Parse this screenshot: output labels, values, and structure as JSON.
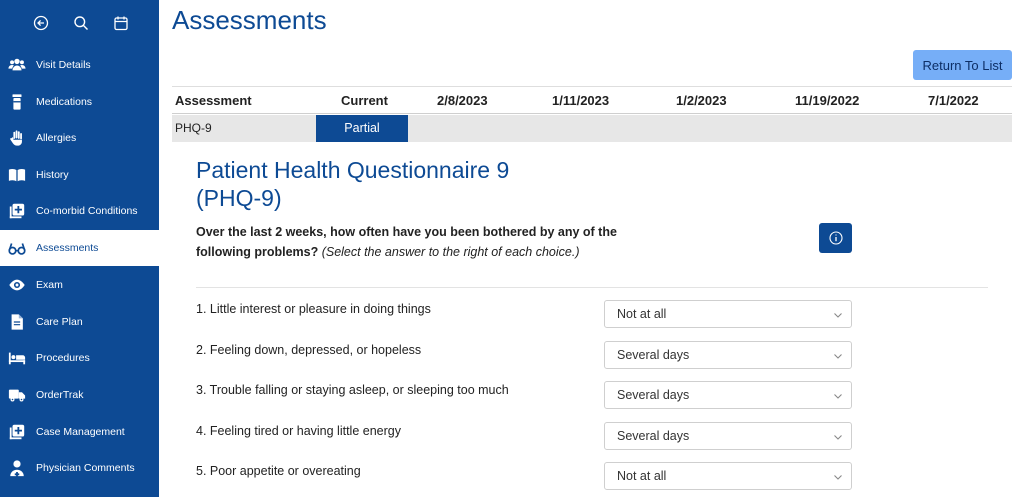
{
  "sidebar": {
    "items": [
      {
        "label": "Visit Details",
        "icon": "users-icon"
      },
      {
        "label": "Medications",
        "icon": "pill-bottle-icon"
      },
      {
        "label": "Allergies",
        "icon": "hand-icon"
      },
      {
        "label": "History",
        "icon": "book-icon"
      },
      {
        "label": "Co-morbid Conditions",
        "icon": "medical-plus-icon"
      },
      {
        "label": "Assessments",
        "icon": "glasses-icon"
      },
      {
        "label": "Exam",
        "icon": "eye-icon"
      },
      {
        "label": "Care Plan",
        "icon": "document-icon"
      },
      {
        "label": "Procedures",
        "icon": "bed-icon"
      },
      {
        "label": "OrderTrak",
        "icon": "truck-icon"
      },
      {
        "label": "Case Management",
        "icon": "medical-plus-icon"
      },
      {
        "label": "Physician Comments",
        "icon": "doctor-icon"
      }
    ],
    "active": "Assessments"
  },
  "header": {
    "title": "Assessments",
    "return_label": "Return To List"
  },
  "table": {
    "columns": [
      "Assessment",
      "Current",
      "2/8/2023",
      "1/11/2023",
      "1/2/2023",
      "11/19/2022",
      "7/1/2022"
    ],
    "row": {
      "name": "PHQ-9",
      "current": "Partial"
    }
  },
  "form": {
    "title": "Patient Health Questionnaire 9 (PHQ-9)",
    "intro_bold": "Over the last 2 weeks, how often have you been bothered by any of the following problems?",
    "intro_italic": "(Select the answer to the right of each choice.)",
    "questions": [
      {
        "label": "1. Little interest or pleasure in doing things",
        "answer": "Not at all"
      },
      {
        "label": "2. Feeling down, depressed, or hopeless",
        "answer": "Several days"
      },
      {
        "label": "3. Trouble falling or staying asleep, or sleeping too much",
        "answer": "Several days"
      },
      {
        "label": "4. Feeling tired or having little energy",
        "answer": "Several days"
      },
      {
        "label": "5. Poor appetite or overeating",
        "answer": "Not at all"
      }
    ]
  },
  "colors": {
    "sidebar_bg": "#0d4a94",
    "accent": "#0d4a94",
    "return_button": "#76aef7",
    "row_bg": "#e7e7e7"
  }
}
